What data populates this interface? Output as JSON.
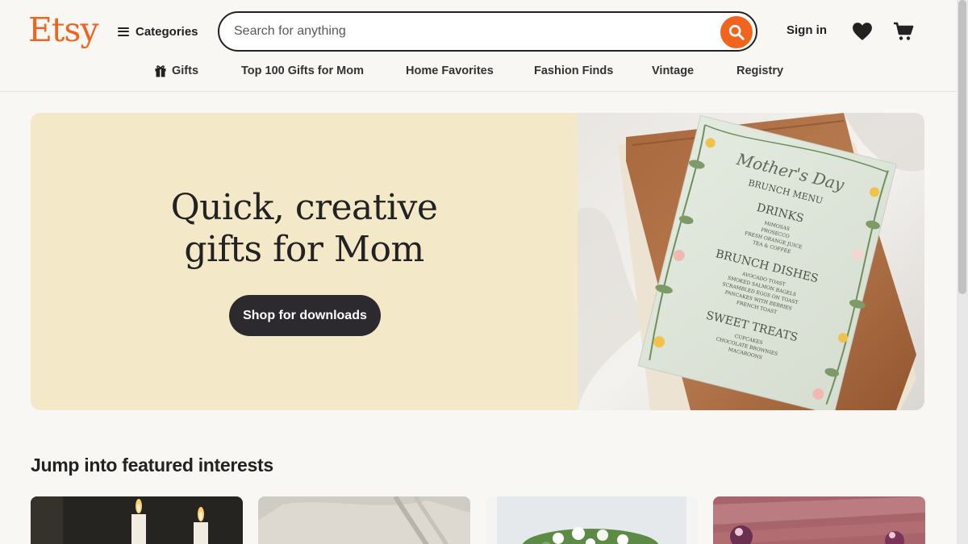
{
  "header": {
    "logo": "Etsy",
    "categories_label": "Categories",
    "search_placeholder": "Search for anything",
    "signin_label": "Sign in"
  },
  "nav": {
    "items": [
      "Gifts",
      "Top 100 Gifts for Mom",
      "Home Favorites",
      "Fashion Finds",
      "Vintage",
      "Registry"
    ]
  },
  "hero": {
    "title_line1": "Quick, creative",
    "title_line2": "gifts for Mom",
    "button": "Shop for downloads",
    "menu_card": {
      "heading": "Mother's Day",
      "subheading": "BRUNCH MENU",
      "drinks_title": "DRINKS",
      "drinks": [
        "MIMOSAS",
        "PROSECCO",
        "FRESH ORANGE JUICE",
        "TEA & COFFEE"
      ],
      "brunch_title": "BRUNCH DISHES",
      "brunch": [
        "AVOCADO TOAST",
        "SMOKED SALMON BAGELS",
        "SCRAMBLED EGGS ON TOAST",
        "PANCAKES WITH BERRIES",
        "FRENCH TOAST"
      ],
      "sweets_title": "SWEET TREATS",
      "sweets": [
        "CUPCAKES",
        "CHOCOLATE BROWNIES",
        "MACAROONS"
      ]
    }
  },
  "featured": {
    "title": "Jump into featured interests"
  },
  "colors": {
    "brand": "#f1641e",
    "hero_bg": "#f3e9c8",
    "button_dark": "#2d2a2f"
  },
  "icons": [
    "menu-icon",
    "search-icon",
    "heart-icon",
    "cart-icon",
    "gift-icon"
  ]
}
